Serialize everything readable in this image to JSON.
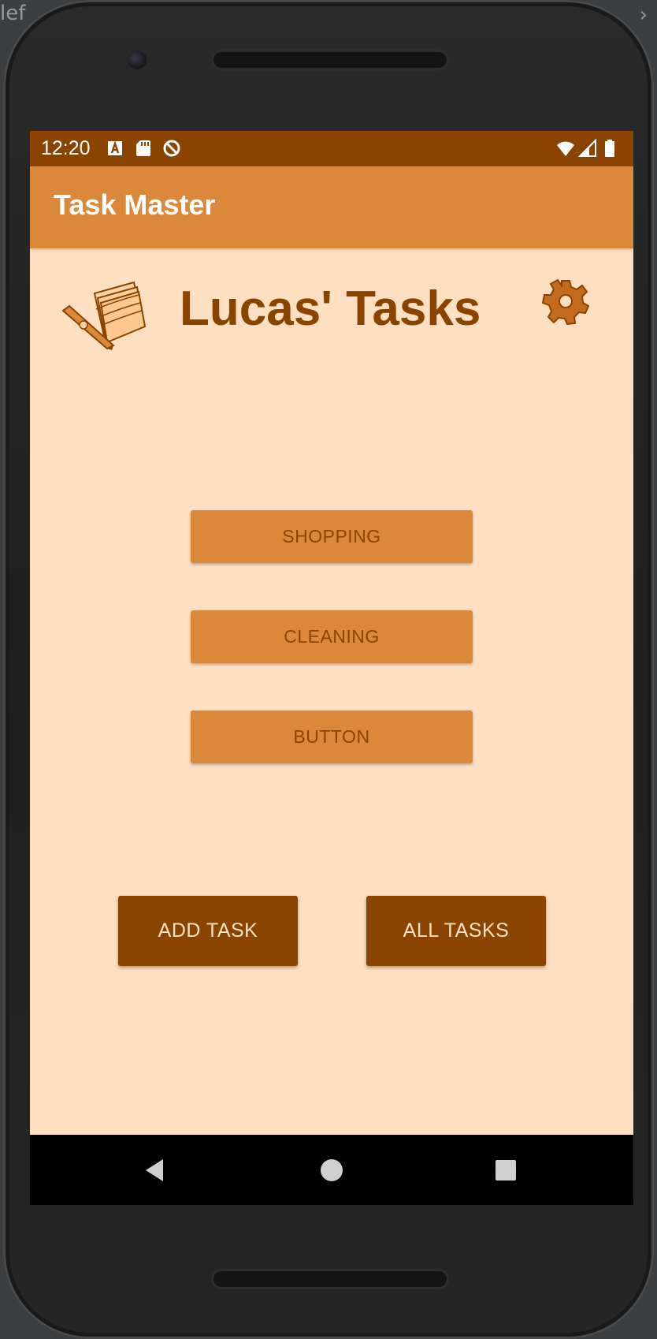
{
  "ide": {
    "tab_fragment": "lef",
    "chevron": "›"
  },
  "status_bar": {
    "time": "12:20",
    "left_icons": [
      "a-letter-icon",
      "sd-card-icon",
      "do-not-disturb-icon"
    ],
    "right_icons": [
      "wifi-icon",
      "signal-icon",
      "battery-icon"
    ]
  },
  "app_bar": {
    "title": "Task Master"
  },
  "header": {
    "logo_icon": "notebook-pen-icon",
    "heading": "Lucas' Tasks",
    "settings_icon": "gear-icon"
  },
  "category_buttons": [
    {
      "label": "SHOPPING"
    },
    {
      "label": "CLEANING"
    },
    {
      "label": "BUTTON"
    }
  ],
  "actions": {
    "add_task": "ADD TASK",
    "all_tasks": "ALL TASKS"
  },
  "nav_bar": {
    "icons": [
      "back-icon",
      "home-icon",
      "recents-icon"
    ]
  },
  "colors": {
    "status_bar": "#8a4400",
    "app_bar": "#dc883b",
    "background": "#ffdfc1",
    "primary_dark": "#8a4400",
    "button_light": "#dc883b"
  }
}
